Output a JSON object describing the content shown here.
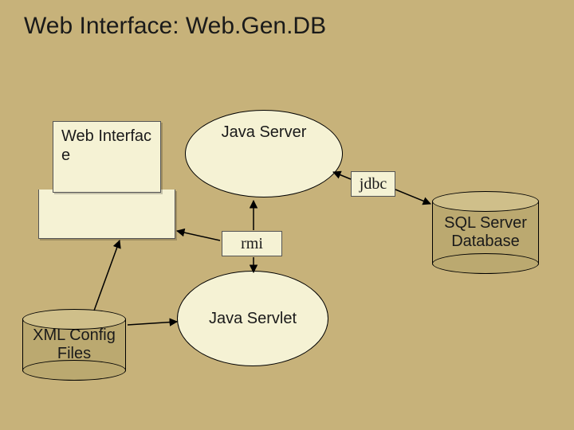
{
  "title": "Web Interface: Web.Gen.DB",
  "nodes": {
    "web_interface": "Web Interfac e",
    "java_server": "Java Server",
    "java_servlet": "Java Servlet",
    "xml_config": "XML Config Files",
    "sql_db": "SQL Server Database"
  },
  "edges": {
    "jdbc": "jdbc",
    "rmi": "rmi"
  }
}
